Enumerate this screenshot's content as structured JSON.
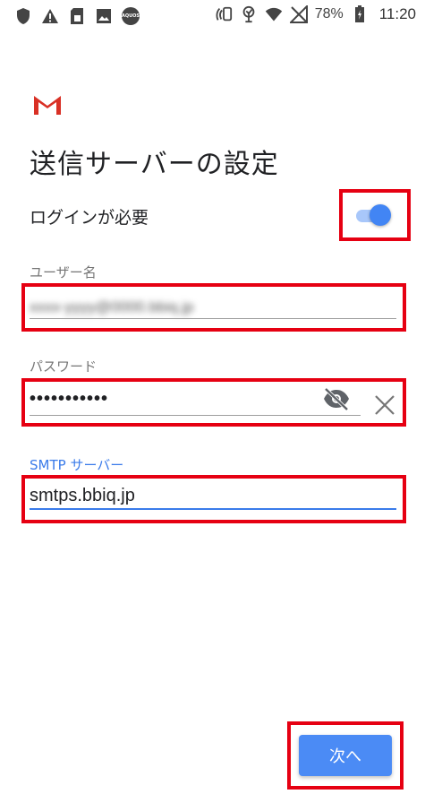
{
  "status_bar": {
    "aquos_label": "AQUOS",
    "battery": "78%",
    "time": "11:20",
    "icons": [
      "shield-icon",
      "warning-icon",
      "sim-card-icon",
      "image-icon",
      "aquos-icon",
      "nfc-icon",
      "hotspot-icon",
      "wifi-icon",
      "no-signal-icon",
      "battery-icon"
    ]
  },
  "screen": {
    "title": "送信サーバーの設定"
  },
  "login_required": {
    "label": "ログインが必要",
    "enabled": true
  },
  "username": {
    "label": "ユーザー名",
    "value": "xxxx-yyyy@0000.bbiq.jp"
  },
  "password": {
    "label": "パスワード",
    "value": "•••••••••••"
  },
  "smtp_server": {
    "label": "SMTP サーバー",
    "value": "smtps.bbiq.jp"
  },
  "next_button": {
    "label": "次へ"
  },
  "colors": {
    "accent": "#3a7bea",
    "highlight": "#e60012",
    "gmail_red": "#d93025"
  }
}
